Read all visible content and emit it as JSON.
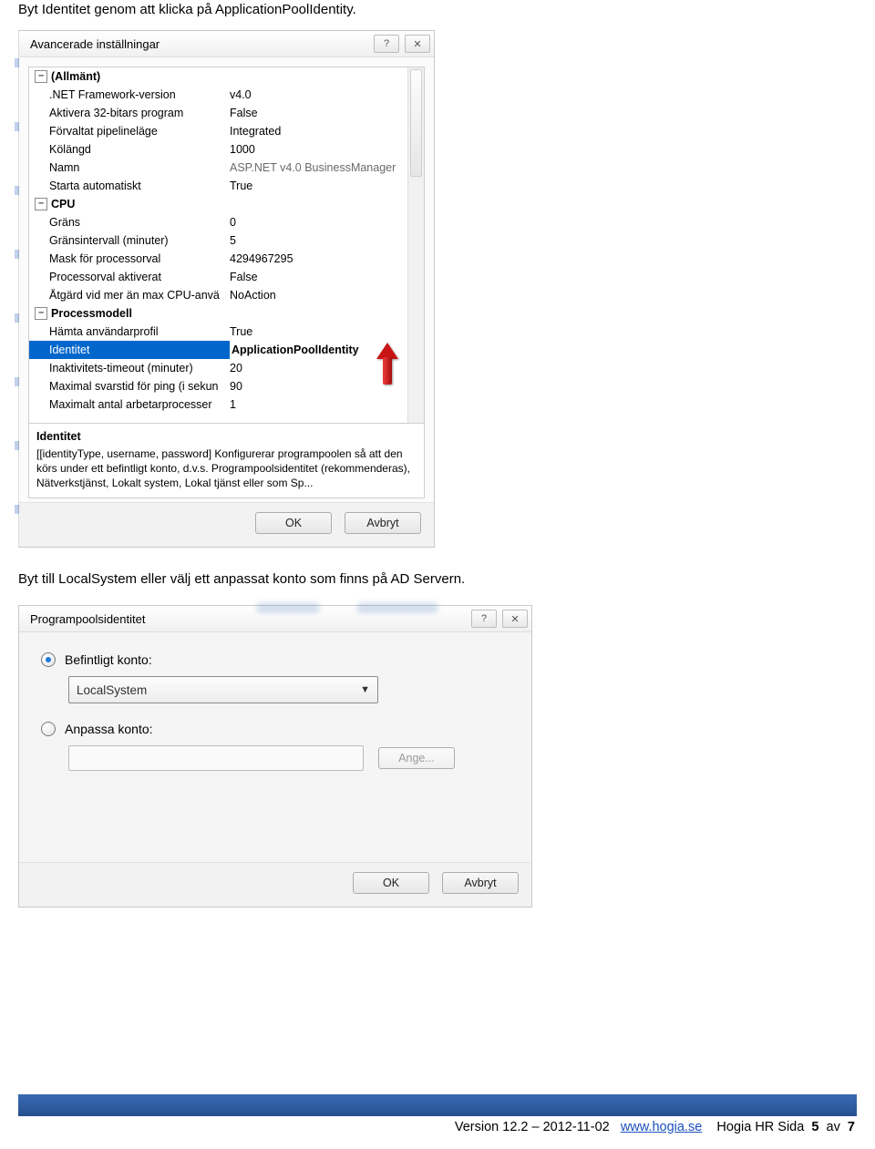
{
  "doc": {
    "text1": "Byt Identitet genom att klicka på ApplicationPoolIdentity.",
    "text2": "Byt till LocalSystem eller välj ett anpassat konto som finns på AD Servern."
  },
  "dialog1": {
    "title": "Avancerade inställningar",
    "ok": "OK",
    "cancel": "Avbryt",
    "desc_title": "Identitet",
    "desc_body": "[[identityType, username, password] Konfigurerar programpoolen så att den körs under ett befintligt konto, d.v.s. Programpoolsidentitet (rekommenderas), Nätverkstjänst, Lokalt system, Lokal tjänst eller som Sp..."
  },
  "grid": {
    "cats": {
      "allmant": "(Allmänt)",
      "cpu": "CPU",
      "process": "Processmodell"
    },
    "rows": {
      "net_framework_name": ".NET Framework-version",
      "net_framework_val": "v4.0",
      "aktivera32_name": "Aktivera 32-bitars program",
      "aktivera32_val": "False",
      "pipeline_name": "Förvaltat pipelineläge",
      "pipeline_val": "Integrated",
      "kolangd_name": "Kölängd",
      "kolangd_val": "1000",
      "namn_name": "Namn",
      "namn_val": "ASP.NET v4.0 BusinessManager",
      "starta_name": "Starta automatiskt",
      "starta_val": "True",
      "grans_name": "Gräns",
      "grans_val": "0",
      "gransint_name": "Gränsintervall (minuter)",
      "gransint_val": "5",
      "mask_name": "Mask för processorval",
      "mask_val": "4294967295",
      "procakt_name": "Processorval aktiverat",
      "procakt_val": "False",
      "atgard_name": "Åtgärd vid mer än max CPU-anvä",
      "atgard_val": "NoAction",
      "hamta_name": "Hämta användarprofil",
      "hamta_val": "True",
      "identitet_name": "Identitet",
      "identitet_val": "ApplicationPoolIdentity",
      "inakt_name": "Inaktivitets-timeout (minuter)",
      "inakt_val": "20",
      "maxsvar_name": "Maximal svarstid för ping (i sekun",
      "maxsvar_val": "90",
      "maxarb_name": "Maximalt antal arbetarprocesser",
      "maxarb_val": "1"
    }
  },
  "dialog2": {
    "title": "Programpoolsidentitet",
    "opt_builtin": "Befintligt konto:",
    "combo_value": "LocalSystem",
    "opt_custom": "Anpassa konto:",
    "set_button": "Ange...",
    "ok": "OK",
    "cancel": "Avbryt"
  },
  "footer": {
    "version_prefix": "Version 12.2 – 2012-11-02",
    "link_text": "www.hogia.se",
    "tail_prefix": "Hogia HR Sida",
    "page_current": "5",
    "tail_mid": "av",
    "page_total": "7"
  }
}
